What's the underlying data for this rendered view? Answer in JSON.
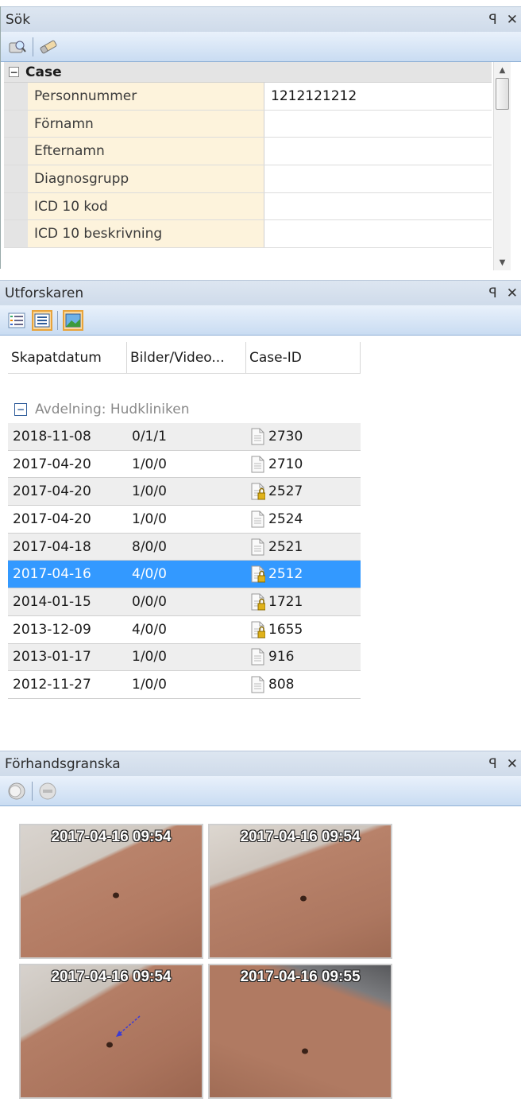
{
  "search": {
    "title": "Sök",
    "pin": "`​",
    "group": "Case",
    "fields": [
      {
        "name": "Personnummer",
        "value": "1212121212"
      },
      {
        "name": "Förnamn",
        "value": ""
      },
      {
        "name": "Efternamn",
        "value": ""
      },
      {
        "name": "Diagnosgrupp",
        "value": ""
      },
      {
        "name": "ICD 10 kod",
        "value": ""
      },
      {
        "name": "ICD 10 beskrivning",
        "value": ""
      }
    ]
  },
  "explorer": {
    "title": "Utforskaren",
    "columns": [
      "Skapatdatum",
      "Bilder/Video...",
      "Case-ID"
    ],
    "group_label": "Avdelning: Hudkliniken",
    "rows": [
      {
        "date": "2018-11-08",
        "media": "0/1/1",
        "case_id": "2730",
        "locked": false,
        "selected": false
      },
      {
        "date": "2017-04-20",
        "media": "1/0/0",
        "case_id": "2710",
        "locked": false,
        "selected": false
      },
      {
        "date": "2017-04-20",
        "media": "1/0/0",
        "case_id": "2527",
        "locked": true,
        "selected": false
      },
      {
        "date": "2017-04-20",
        "media": "1/0/0",
        "case_id": "2524",
        "locked": false,
        "selected": false
      },
      {
        "date": "2017-04-18",
        "media": "8/0/0",
        "case_id": "2521",
        "locked": false,
        "selected": false
      },
      {
        "date": "2017-04-16",
        "media": "4/0/0",
        "case_id": "2512",
        "locked": true,
        "selected": true
      },
      {
        "date": "2014-01-15",
        "media": "0/0/0",
        "case_id": "1721",
        "locked": true,
        "selected": false
      },
      {
        "date": "2013-12-09",
        "media": "4/0/0",
        "case_id": "1655",
        "locked": true,
        "selected": false
      },
      {
        "date": "2013-01-17",
        "media": "1/0/0",
        "case_id": "916",
        "locked": false,
        "selected": false
      },
      {
        "date": "2012-11-27",
        "media": "1/0/0",
        "case_id": "808",
        "locked": false,
        "selected": false
      }
    ]
  },
  "preview": {
    "title": "Förhandsgranska",
    "thumbnails": [
      {
        "timestamp": "2017-04-16 09:54"
      },
      {
        "timestamp": "2017-04-16 09:54"
      },
      {
        "timestamp": "2017-04-16 09:54"
      },
      {
        "timestamp": "2017-04-16 09:55"
      }
    ]
  },
  "colors": {
    "selection": "#3399ff",
    "property_name_bg": "#fdf3dc",
    "header_bg": "#cfdbea"
  },
  "icons": {
    "pin": "pin-icon",
    "close": "close-icon"
  }
}
